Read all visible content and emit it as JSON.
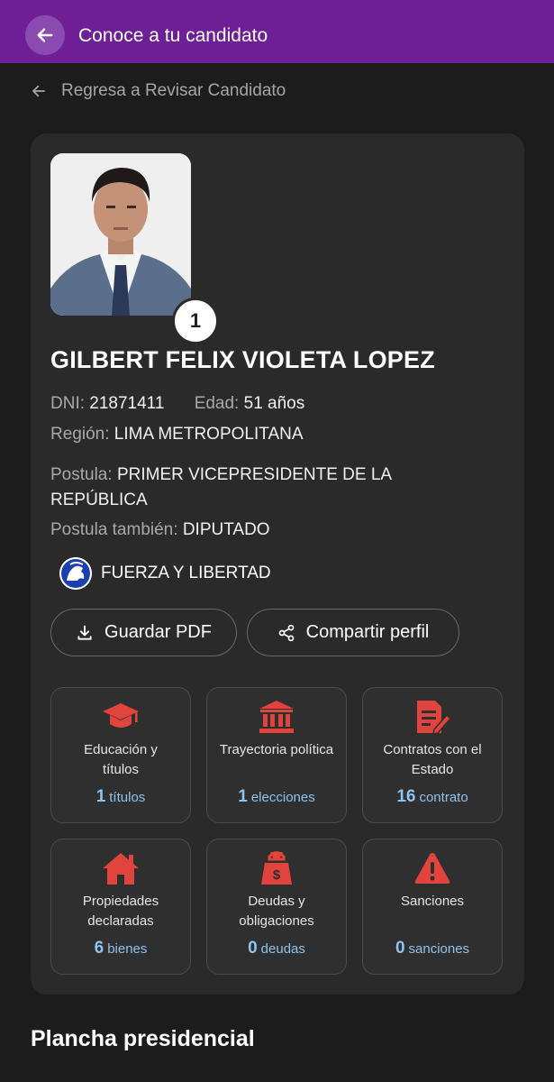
{
  "header": {
    "title": "Conoce a tu candidato",
    "back_icon": "arrow-left-icon"
  },
  "breadcrumb": {
    "label": "Regresa a Revisar Candidato"
  },
  "candidate": {
    "number": "1",
    "name": "GILBERT FELIX VIOLETA LOPEZ",
    "dni_label": "DNI:",
    "dni": "21871411",
    "age_label": "Edad:",
    "age": "51 años",
    "region_label": "Región:",
    "region": "LIMA METROPOLITANA",
    "postula_label": "Postula:",
    "postula_line1": "PRIMER VICEPRESIDENTE DE LA",
    "postula_line2": "REPÚBLICA",
    "postula_tambien_label": "Postula también:",
    "postula_tambien": "DIPUTADO",
    "party": "FUERZA Y LIBERTAD"
  },
  "actions": {
    "save_pdf": "Guardar PDF",
    "share": "Compartir perfil"
  },
  "tiles": [
    {
      "line1": "Educación y",
      "line2": "títulos",
      "count": "1",
      "unit": "títulos",
      "icon": "graduation-cap-icon"
    },
    {
      "line1": "Trayectoria política",
      "line2": "",
      "count": "1",
      "unit": "elecciones",
      "icon": "government-building-icon"
    },
    {
      "line1": "Contratos con el",
      "line2": "Estado",
      "count": "16",
      "unit": "contrato",
      "icon": "contract-document-icon"
    },
    {
      "line1": "Propiedades",
      "line2": "declaradas",
      "count": "6",
      "unit": "bienes",
      "icon": "house-icon"
    },
    {
      "line1": "Deudas y",
      "line2": "obligaciones",
      "count": "0",
      "unit": "deudas",
      "icon": "money-bag-icon"
    },
    {
      "line1": "Sanciones",
      "line2": "",
      "count": "0",
      "unit": "sanciones",
      "icon": "warning-icon"
    }
  ],
  "section": {
    "title": "Plancha presidencial"
  },
  "colors": {
    "topbar": "#6e1f96",
    "icon_red": "#e0443c",
    "stat_blue": "#8ec3ee",
    "background": "#1c1c1c",
    "card": "#2a2a2a"
  }
}
